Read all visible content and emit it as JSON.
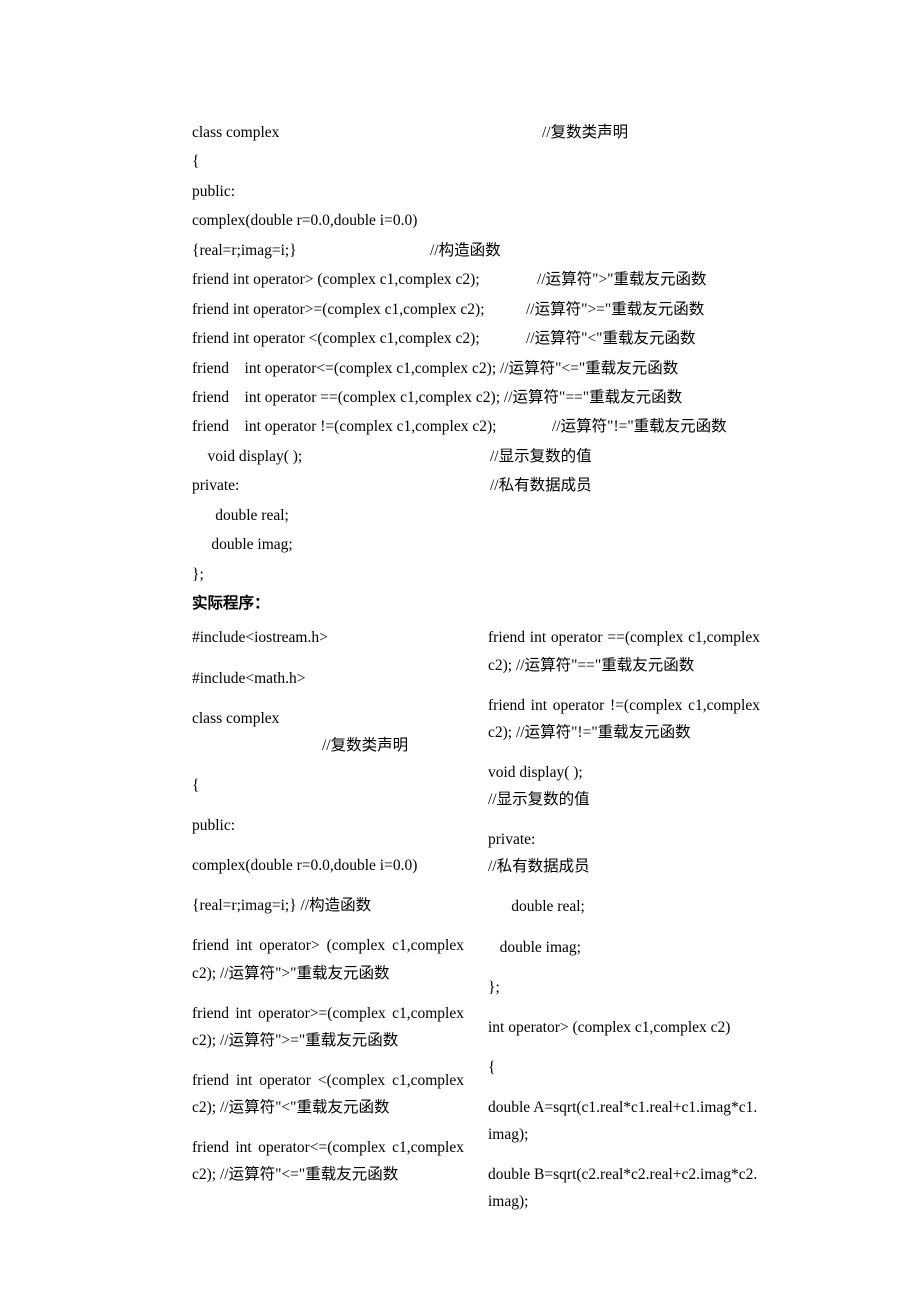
{
  "top": {
    "l1a": "class complex",
    "l1b": "//复数类声明",
    "l2": "{",
    "l3": "public:",
    "l4": "complex(double r=0.0,double i=0.0)",
    "l5a": "{real=r;imag=i;}",
    "l5b": "//构造函数",
    "l6a": "friend int operator> (complex c1,complex c2);",
    "l6b": "//运算符\">\"重载友元函数",
    "l7a": "friend int operator>=(complex c1,complex c2);",
    "l7b": "//运算符\">=\"重载友元函数",
    "l8a": "friend int operator <(complex c1,complex c2);",
    "l8b": "//运算符\"<\"重载友元函数",
    "l9": "friend    int operator<=(complex c1,complex c2); //运算符\"<=\"重载友元函数",
    "l10": "friend    int operator ==(complex c1,complex c2); //运算符\"==\"重载友元函数",
    "l11a": "friend    int operator !=(complex c1,complex c2);",
    "l11b": "//运算符\"!=\"重载友元函数",
    "l12a": "    void display( );",
    "l12b": "//显示复数的值",
    "l13a": "private:",
    "l13b": "//私有数据成员",
    "l14": "      double real;",
    "l15": "     double imag;",
    "l16": "};"
  },
  "heading": "实际程序：",
  "left": {
    "p1": "#include<iostream.h>",
    "p2": "#include<math.h>",
    "p3a": "class complex",
    "p3b": "//复数类声明",
    "p4": "{",
    "p5": "public:",
    "p6": "complex(double r=0.0,double i=0.0)",
    "p7": "{real=r;imag=i;}                        //构造函数",
    "p8": "friend   int   operator>  (complex c1,complex c2);       //运算符\">\"重载友元函数",
    "p9": "friend    int    operator>=(complex c1,complex c2);   //运算符\">=\"重载友元函数",
    "p10": "friend    int    operator   <(complex c1,complex c2);     //运算符\"<\"重载友元函数",
    "p11": "friend    int    operator<=(complex c1,complex c2); //运算符\"<=\"重载友元函数"
  },
  "right": {
    "p1": "friend   int   operator   ==(complex c1,complex c2); //运算符\"==\"重载友元函数",
    "p2": "friend   int   operator   !=(complex c1,complex c2);    //运算符\"!=\"重载友元函数",
    "p3a": "void display( );",
    "p3b": "//显示复数的值",
    "p4a": "private:",
    "p4b": "//私有数据成员",
    "p5": "      double real;",
    "p6": "   double imag;",
    "p7": "};",
    "p8": "int operator> (complex c1,complex c2)",
    "p9": "{",
    "p10": "double A=sqrt(c1.real*c1.real+c1.imag*c1.imag);",
    "p11": "double B=sqrt(c2.real*c2.real+c2.imag*c2.imag);"
  }
}
